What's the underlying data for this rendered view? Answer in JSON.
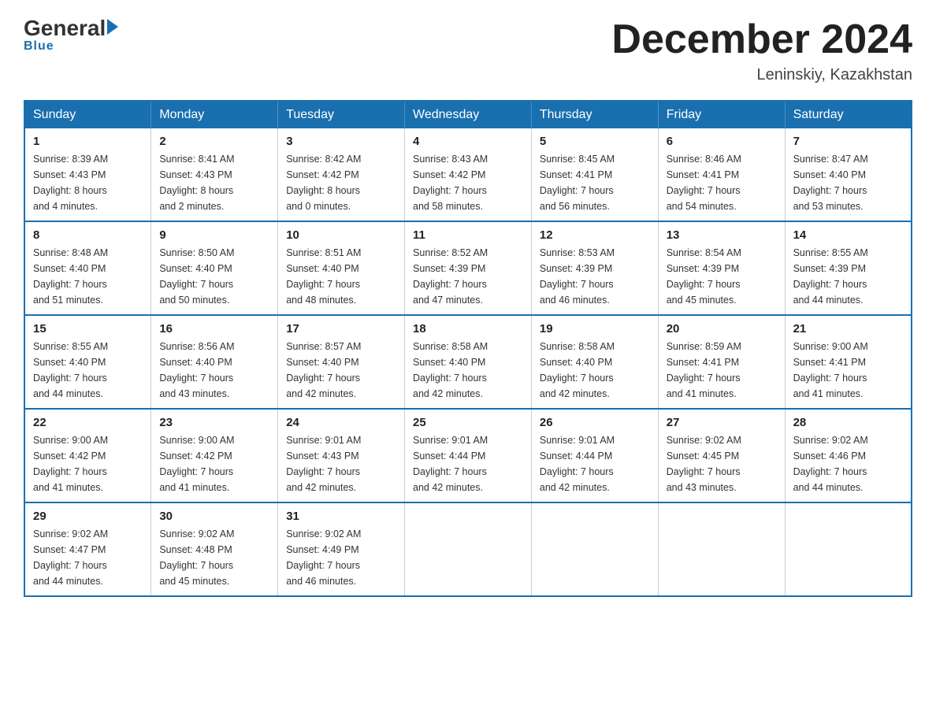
{
  "header": {
    "logo": {
      "general": "General",
      "arrow": "",
      "blue": "Blue"
    },
    "title": "December 2024",
    "location": "Leninskiy, Kazakhstan"
  },
  "days_of_week": [
    "Sunday",
    "Monday",
    "Tuesday",
    "Wednesday",
    "Thursday",
    "Friday",
    "Saturday"
  ],
  "weeks": [
    [
      {
        "day": "1",
        "sunrise": "8:39 AM",
        "sunset": "4:43 PM",
        "daylight": "8 hours and 4 minutes."
      },
      {
        "day": "2",
        "sunrise": "8:41 AM",
        "sunset": "4:43 PM",
        "daylight": "8 hours and 2 minutes."
      },
      {
        "day": "3",
        "sunrise": "8:42 AM",
        "sunset": "4:42 PM",
        "daylight": "8 hours and 0 minutes."
      },
      {
        "day": "4",
        "sunrise": "8:43 AM",
        "sunset": "4:42 PM",
        "daylight": "7 hours and 58 minutes."
      },
      {
        "day": "5",
        "sunrise": "8:45 AM",
        "sunset": "4:41 PM",
        "daylight": "7 hours and 56 minutes."
      },
      {
        "day": "6",
        "sunrise": "8:46 AM",
        "sunset": "4:41 PM",
        "daylight": "7 hours and 54 minutes."
      },
      {
        "day": "7",
        "sunrise": "8:47 AM",
        "sunset": "4:40 PM",
        "daylight": "7 hours and 53 minutes."
      }
    ],
    [
      {
        "day": "8",
        "sunrise": "8:48 AM",
        "sunset": "4:40 PM",
        "daylight": "7 hours and 51 minutes."
      },
      {
        "day": "9",
        "sunrise": "8:50 AM",
        "sunset": "4:40 PM",
        "daylight": "7 hours and 50 minutes."
      },
      {
        "day": "10",
        "sunrise": "8:51 AM",
        "sunset": "4:40 PM",
        "daylight": "7 hours and 48 minutes."
      },
      {
        "day": "11",
        "sunrise": "8:52 AM",
        "sunset": "4:39 PM",
        "daylight": "7 hours and 47 minutes."
      },
      {
        "day": "12",
        "sunrise": "8:53 AM",
        "sunset": "4:39 PM",
        "daylight": "7 hours and 46 minutes."
      },
      {
        "day": "13",
        "sunrise": "8:54 AM",
        "sunset": "4:39 PM",
        "daylight": "7 hours and 45 minutes."
      },
      {
        "day": "14",
        "sunrise": "8:55 AM",
        "sunset": "4:39 PM",
        "daylight": "7 hours and 44 minutes."
      }
    ],
    [
      {
        "day": "15",
        "sunrise": "8:55 AM",
        "sunset": "4:40 PM",
        "daylight": "7 hours and 44 minutes."
      },
      {
        "day": "16",
        "sunrise": "8:56 AM",
        "sunset": "4:40 PM",
        "daylight": "7 hours and 43 minutes."
      },
      {
        "day": "17",
        "sunrise": "8:57 AM",
        "sunset": "4:40 PM",
        "daylight": "7 hours and 42 minutes."
      },
      {
        "day": "18",
        "sunrise": "8:58 AM",
        "sunset": "4:40 PM",
        "daylight": "7 hours and 42 minutes."
      },
      {
        "day": "19",
        "sunrise": "8:58 AM",
        "sunset": "4:40 PM",
        "daylight": "7 hours and 42 minutes."
      },
      {
        "day": "20",
        "sunrise": "8:59 AM",
        "sunset": "4:41 PM",
        "daylight": "7 hours and 41 minutes."
      },
      {
        "day": "21",
        "sunrise": "9:00 AM",
        "sunset": "4:41 PM",
        "daylight": "7 hours and 41 minutes."
      }
    ],
    [
      {
        "day": "22",
        "sunrise": "9:00 AM",
        "sunset": "4:42 PM",
        "daylight": "7 hours and 41 minutes."
      },
      {
        "day": "23",
        "sunrise": "9:00 AM",
        "sunset": "4:42 PM",
        "daylight": "7 hours and 41 minutes."
      },
      {
        "day": "24",
        "sunrise": "9:01 AM",
        "sunset": "4:43 PM",
        "daylight": "7 hours and 42 minutes."
      },
      {
        "day": "25",
        "sunrise": "9:01 AM",
        "sunset": "4:44 PM",
        "daylight": "7 hours and 42 minutes."
      },
      {
        "day": "26",
        "sunrise": "9:01 AM",
        "sunset": "4:44 PM",
        "daylight": "7 hours and 42 minutes."
      },
      {
        "day": "27",
        "sunrise": "9:02 AM",
        "sunset": "4:45 PM",
        "daylight": "7 hours and 43 minutes."
      },
      {
        "day": "28",
        "sunrise": "9:02 AM",
        "sunset": "4:46 PM",
        "daylight": "7 hours and 44 minutes."
      }
    ],
    [
      {
        "day": "29",
        "sunrise": "9:02 AM",
        "sunset": "4:47 PM",
        "daylight": "7 hours and 44 minutes."
      },
      {
        "day": "30",
        "sunrise": "9:02 AM",
        "sunset": "4:48 PM",
        "daylight": "7 hours and 45 minutes."
      },
      {
        "day": "31",
        "sunrise": "9:02 AM",
        "sunset": "4:49 PM",
        "daylight": "7 hours and 46 minutes."
      },
      null,
      null,
      null,
      null
    ]
  ],
  "labels": {
    "sunrise": "Sunrise:",
    "sunset": "Sunset:",
    "daylight": "Daylight:"
  }
}
